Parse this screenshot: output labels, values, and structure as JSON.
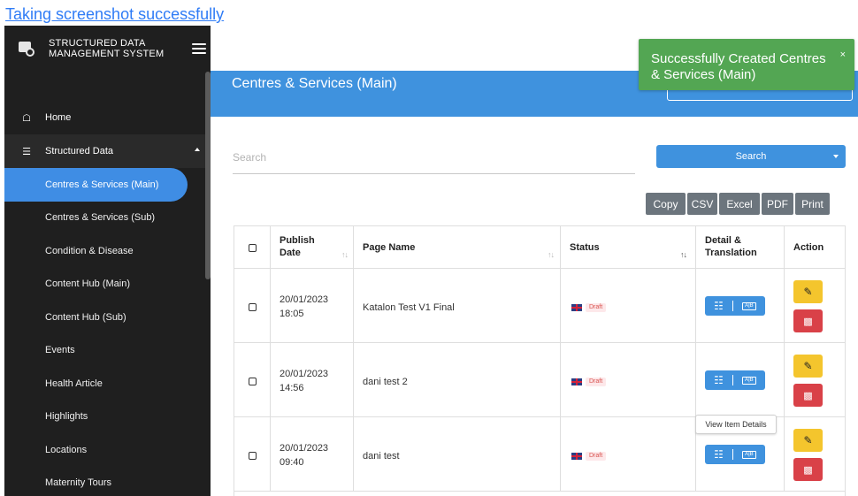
{
  "caption": "Taking screenshot successfully",
  "sidebar": {
    "brand": "STRUCTURED DATA MANAGEMENT SYSTEM",
    "home": "Home",
    "structured": "Structured Data",
    "items": [
      "Centres & Services (Main)",
      "Centres & Services (Sub)",
      "Condition & Disease",
      "Content Hub (Main)",
      "Content Hub (Sub)",
      "Events",
      "Health Article",
      "Highlights",
      "Locations",
      "Maternity Tours"
    ]
  },
  "banner": {
    "title": "Centres & Services (Main)"
  },
  "toast": {
    "message": "Successfully Created Centres & Services (Main)",
    "close": "×"
  },
  "search": {
    "placeholder": "Search",
    "button": "Search"
  },
  "exports": [
    "Copy",
    "CSV",
    "Excel",
    "PDF",
    "Print"
  ],
  "table": {
    "headers": {
      "publish_date": "Publish Date",
      "page_name": "Page Name",
      "status": "Status",
      "detail": "Detail & Translation",
      "action": "Action"
    },
    "rows": [
      {
        "date": "20/01/2023",
        "time": "18:05",
        "name": "Katalon Test V1 Final",
        "status": "Draft"
      },
      {
        "date": "20/01/2023",
        "time": "14:56",
        "name": "dani test 2",
        "status": "Draft"
      },
      {
        "date": "20/01/2023",
        "time": "09:40",
        "name": "dani test",
        "status": "Draft"
      }
    ]
  },
  "tooltip": "View Item Details",
  "colors": {
    "accent": "#3f92de",
    "sidebar": "#1f1f1f",
    "toast": "#53a653",
    "edit": "#f4c52d",
    "delete": "#d94148"
  }
}
